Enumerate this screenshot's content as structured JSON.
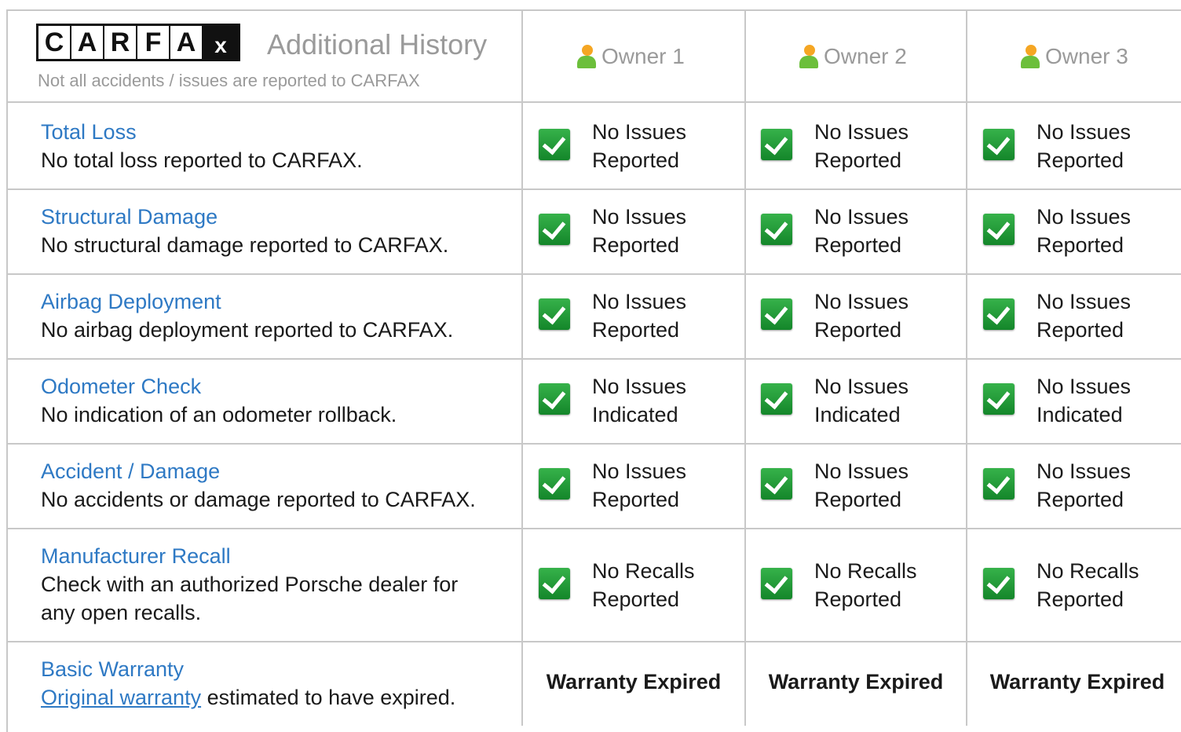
{
  "header": {
    "logo_letters": [
      "C",
      "A",
      "R",
      "F",
      "A",
      "x"
    ],
    "logo_text": "CARFAX",
    "title": "Additional History",
    "subtitle": "Not all accidents / issues are reported to CARFAX"
  },
  "owners": [
    {
      "label": "Owner 1",
      "icon": "person-icon"
    },
    {
      "label": "Owner 2",
      "icon": "person-icon"
    },
    {
      "label": "Owner 3",
      "icon": "person-icon"
    }
  ],
  "rows": [
    {
      "title": "Total Loss",
      "desc": "No total loss reported to CARFAX.",
      "status_line1": "No Issues",
      "status_line2": "Reported"
    },
    {
      "title": "Structural Damage",
      "desc": "No structural damage reported to CARFAX.",
      "status_line1": "No Issues",
      "status_line2": "Reported"
    },
    {
      "title": "Airbag Deployment",
      "desc": "No airbag deployment reported to CARFAX.",
      "status_line1": "No Issues",
      "status_line2": "Reported"
    },
    {
      "title": "Odometer Check",
      "desc": "No indication of an odometer rollback.",
      "status_line1": "No Issues",
      "status_line2": "Indicated"
    },
    {
      "title": "Accident / Damage",
      "desc": "No accidents or damage reported to CARFAX.",
      "status_line1": "No Issues",
      "status_line2": "Reported"
    },
    {
      "title": "Manufacturer Recall",
      "desc_line1": "Check with an authorized Porsche dealer for",
      "desc_line2": "any open recalls.",
      "status_line1": "No Recalls",
      "status_line2": "Reported"
    }
  ],
  "warranty": {
    "title": "Basic Warranty",
    "link_text": "Original warranty",
    "desc_rest": " estimated to have expired.",
    "status": "Warranty Expired"
  },
  "colors": {
    "link": "#2e79c4",
    "check": "#1e9a36",
    "border": "#c8c8c8",
    "muted": "#9a9a9a"
  }
}
